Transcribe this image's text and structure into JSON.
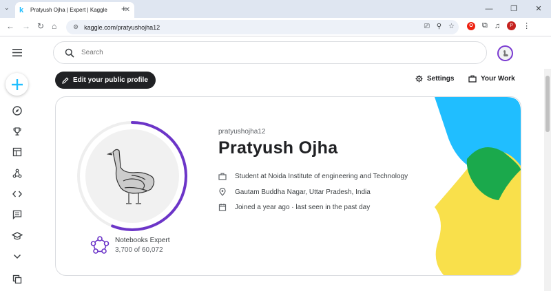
{
  "browser": {
    "tab_title": "Pratyush Ojha | Expert | Kaggle",
    "url": "kaggle.com/pratyushojha12",
    "profile_initial": "P"
  },
  "search": {
    "placeholder": "Search"
  },
  "actions": {
    "edit_profile": "Edit your public profile",
    "settings": "Settings",
    "your_work": "Your Work"
  },
  "profile": {
    "username": "pratyushojha12",
    "name": "Pratyush Ojha",
    "occupation": "Student at Noida Institute of engineering and Technology",
    "location": "Gautam Buddha Nagar, Uttar Pradesh, India",
    "joined": "Joined a year ago · last seen in the past day",
    "tier_label": "Notebooks Expert",
    "rank": "3,700 of 60,072",
    "progress_fraction": 0.56
  },
  "colors": {
    "accent_purple": "#6c35c8",
    "kaggle_blue": "#20beff",
    "art_green": "#1ba94c",
    "art_yellow": "#f9e04b"
  }
}
